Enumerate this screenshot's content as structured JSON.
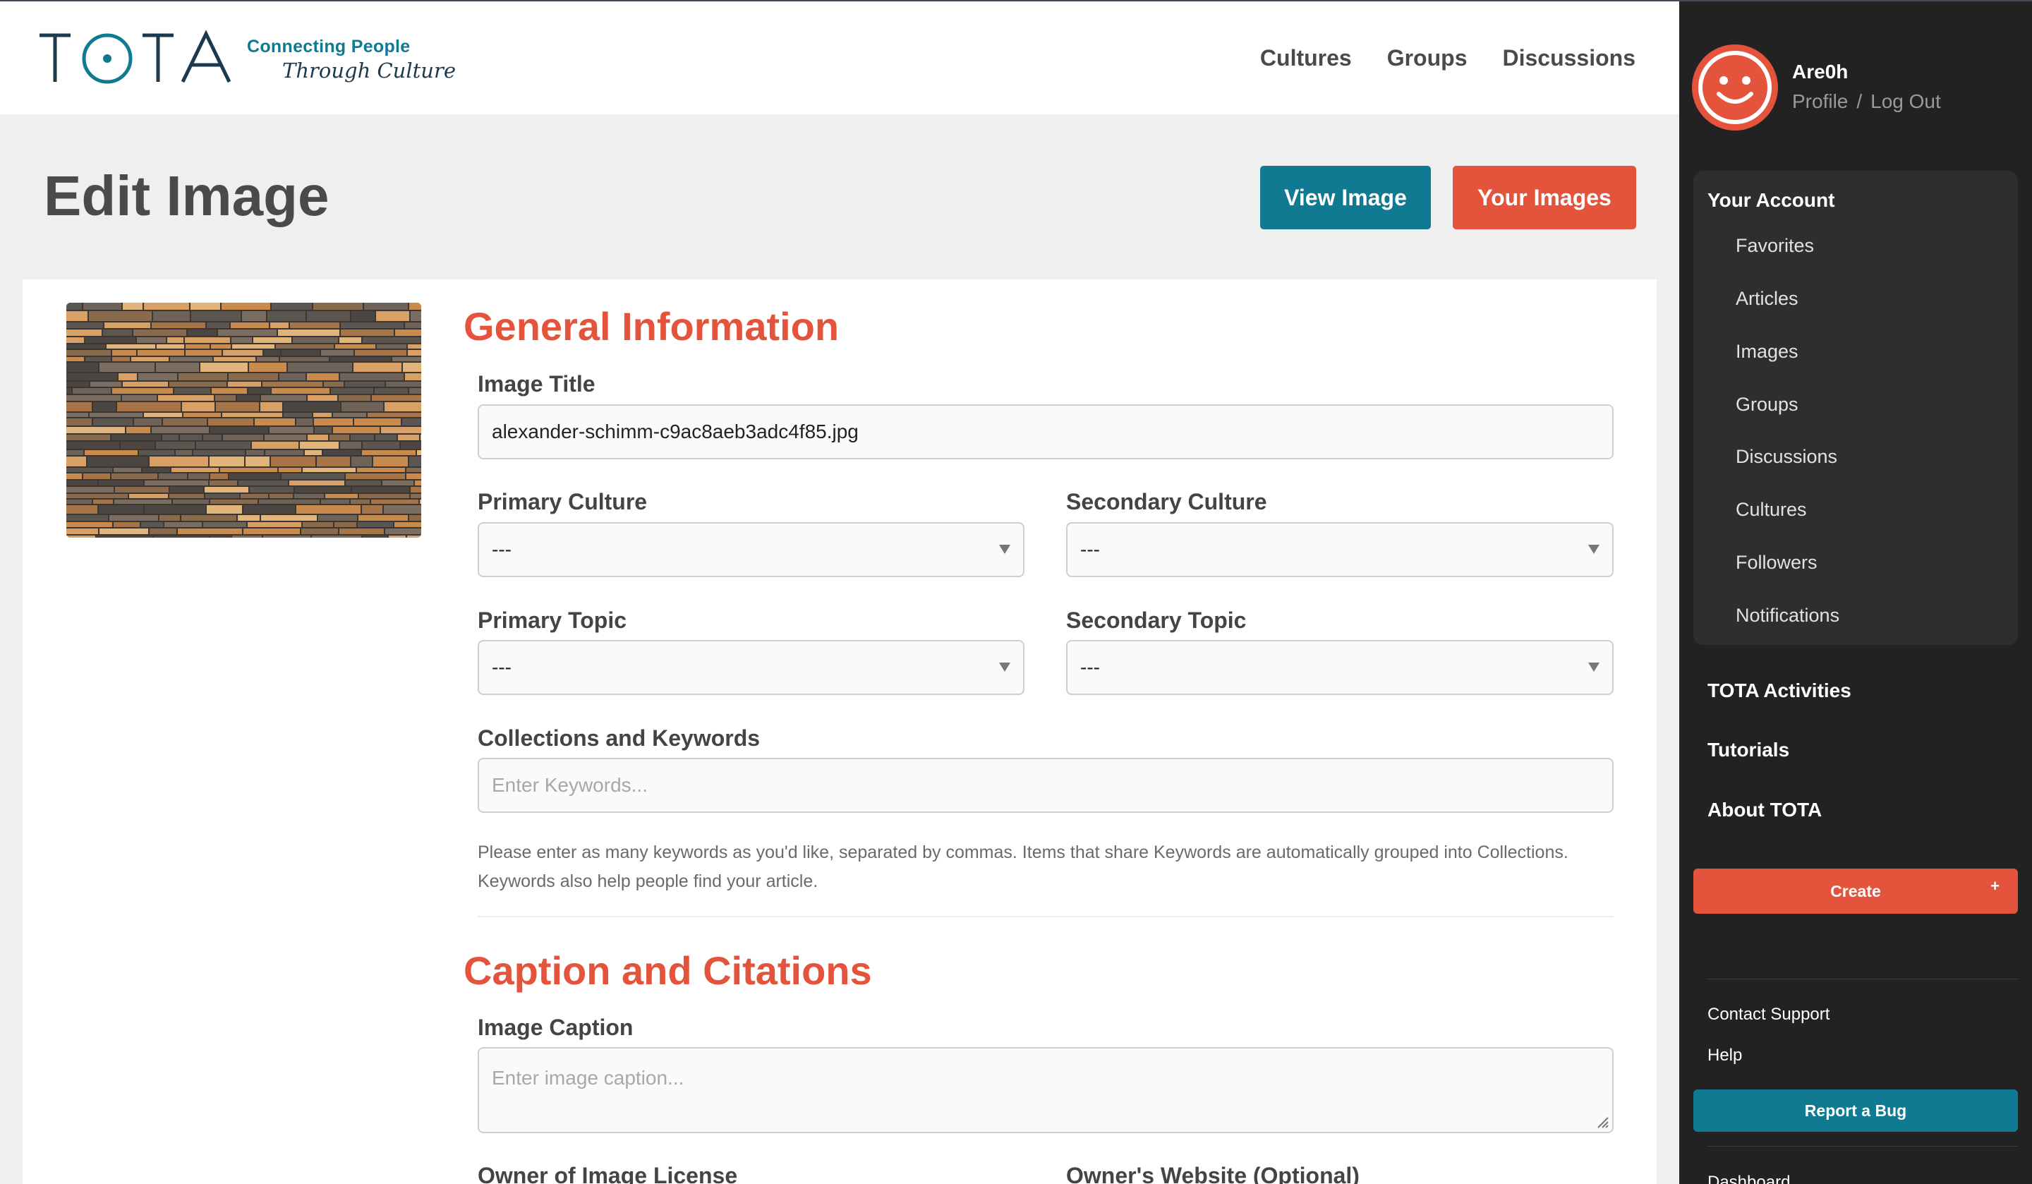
{
  "brand": {
    "logo_text": "TOTA",
    "tagline_line1": "Connecting People",
    "tagline_line2": "Through Culture",
    "colors": {
      "teal": "#0f7a91",
      "coral": "#e4533b",
      "navy": "#1d3a4d"
    }
  },
  "topnav": [
    "Cultures",
    "Groups",
    "Discussions"
  ],
  "page": {
    "title": "Edit Image",
    "view_button": "View Image",
    "your_images_button": "Your Images"
  },
  "thumbnail": {
    "alt": "stacked wooden planks"
  },
  "general": {
    "heading": "General Information",
    "image_title_label": "Image Title",
    "image_title_value": "alexander-schimm-c9ac8aeb3adc4f85.jpg",
    "primary_culture_label": "Primary Culture",
    "primary_culture_value": "---",
    "secondary_culture_label": "Secondary Culture",
    "secondary_culture_value": "---",
    "primary_topic_label": "Primary Topic",
    "primary_topic_value": "---",
    "secondary_topic_label": "Secondary Topic",
    "secondary_topic_value": "---",
    "keywords_label": "Collections and Keywords",
    "keywords_placeholder": "Enter Keywords...",
    "keywords_help_line1": "Please enter as many keywords as you'd like, separated by commas. Items that share Keywords are automatically grouped into Collections.",
    "keywords_help_line2": "Keywords also help people find your article."
  },
  "caption": {
    "heading": "Caption and Citations",
    "image_caption_label": "Image Caption",
    "image_caption_placeholder": "Enter image caption...",
    "owner_license_label": "Owner of Image License",
    "owner_website_label": "Owner's Website (Optional)"
  },
  "sidebar": {
    "username": "Are0h",
    "profile_link": "Profile",
    "separator": "/",
    "logout_link": "Log Out",
    "account_title": "Your Account",
    "account_items": [
      "Favorites",
      "Articles",
      "Images",
      "Groups",
      "Discussions",
      "Cultures",
      "Followers",
      "Notifications"
    ],
    "links": [
      "TOTA Activities",
      "Tutorials",
      "About TOTA"
    ],
    "create_label": "Create",
    "create_plus": "+",
    "contact_support": "Contact Support",
    "help": "Help",
    "report_bug": "Report a Bug",
    "dashboard": "Dashboard"
  }
}
